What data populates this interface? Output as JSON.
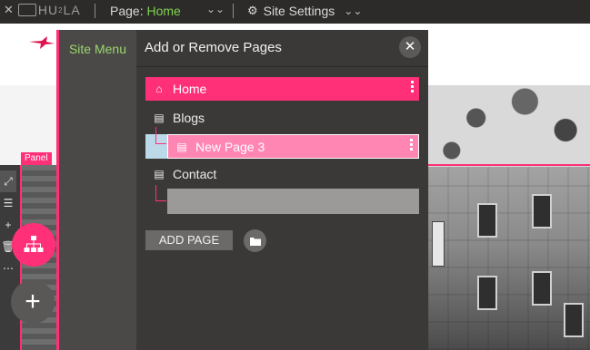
{
  "topbar": {
    "close_glyph": "✕",
    "logo_text": "HU",
    "logo_sup": "2",
    "logo_text2": "LA",
    "page_label": "Page:",
    "page_value": "Home",
    "settings_label": "Site Settings"
  },
  "panel_tag": "Panel",
  "site_menu": {
    "tab_label": "Site Menu",
    "title": "Add or Remove Pages",
    "pages": [
      {
        "label": "Home",
        "icon": "home-icon"
      },
      {
        "label": "Blogs",
        "icon": "document-icon"
      },
      {
        "label": "New Page 3",
        "icon": "document-icon"
      },
      {
        "label": "Contact",
        "icon": "document-icon"
      }
    ],
    "add_page_label": "ADD PAGE"
  },
  "colors": {
    "accent": "#ff2f78",
    "page_value": "#7fd14e",
    "menu_bg": "#3b3938",
    "highlight_row": "#ff85b3",
    "hover_band": "#bcd9ea"
  }
}
